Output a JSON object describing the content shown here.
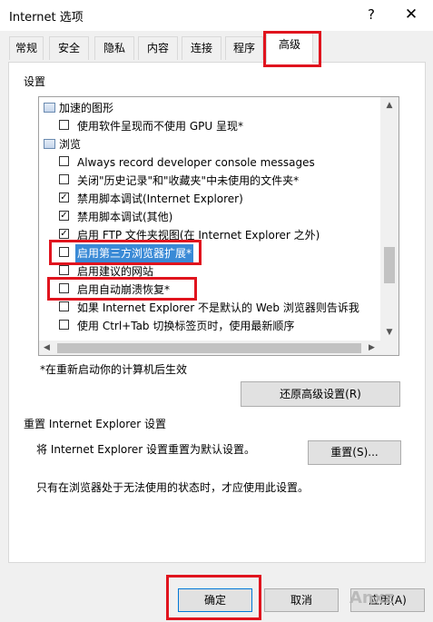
{
  "window": {
    "title": "Internet 选项",
    "help": "?",
    "close": "✕"
  },
  "tabs": [
    {
      "label": "常规"
    },
    {
      "label": "安全"
    },
    {
      "label": "隐私"
    },
    {
      "label": "内容"
    },
    {
      "label": "连接"
    },
    {
      "label": "程序"
    },
    {
      "label": "高级",
      "active": true
    }
  ],
  "settings": {
    "label": "设置",
    "rows": [
      {
        "kind": "category",
        "text": "加速的图形"
      },
      {
        "kind": "checkbox",
        "checked": false,
        "text": "使用软件呈现而不使用 GPU 呈现*"
      },
      {
        "kind": "category",
        "text": "浏览"
      },
      {
        "kind": "checkbox",
        "checked": false,
        "text": "Always record developer console messages"
      },
      {
        "kind": "checkbox",
        "checked": false,
        "text": "关闭\"历史记录\"和\"收藏夹\"中未使用的文件夹*"
      },
      {
        "kind": "checkbox",
        "checked": true,
        "text": "禁用脚本调试(Internet Explorer)"
      },
      {
        "kind": "checkbox",
        "checked": true,
        "text": "禁用脚本调试(其他)"
      },
      {
        "kind": "checkbox",
        "checked": true,
        "text": "启用 FTP 文件夹视图(在 Internet Explorer 之外)"
      },
      {
        "kind": "checkbox",
        "checked": false,
        "text": "启用第三方浏览器扩展*",
        "selected": true
      },
      {
        "kind": "checkbox",
        "checked": false,
        "text": "启用建议的网站"
      },
      {
        "kind": "checkbox",
        "checked": false,
        "text": "启用自动崩溃恢复*"
      },
      {
        "kind": "checkbox",
        "checked": false,
        "text": "如果 Internet Explorer 不是默认的 Web 浏览器则告诉我"
      },
      {
        "kind": "checkbox",
        "checked": false,
        "text": "使用 Ctrl+Tab 切换标签页时，使用最新顺序"
      }
    ]
  },
  "restart_note": "*在重新启动你的计算机后生效",
  "restore_advanced_button": "还原高级设置(R)",
  "reset": {
    "group_label": "重置 Internet Explorer 设置",
    "description": "将 Internet Explorer 设置重置为默认设置。",
    "button": "重置(S)...",
    "note": "只有在浏览器处于无法使用的状态时，才应使用此设置。"
  },
  "footer": {
    "ok": "确定",
    "cancel": "取消",
    "apply": "应用(A)"
  },
  "watermark": "Anxz",
  "colors": {
    "highlight": "#e0141e",
    "selection": "#3a8ad6"
  }
}
